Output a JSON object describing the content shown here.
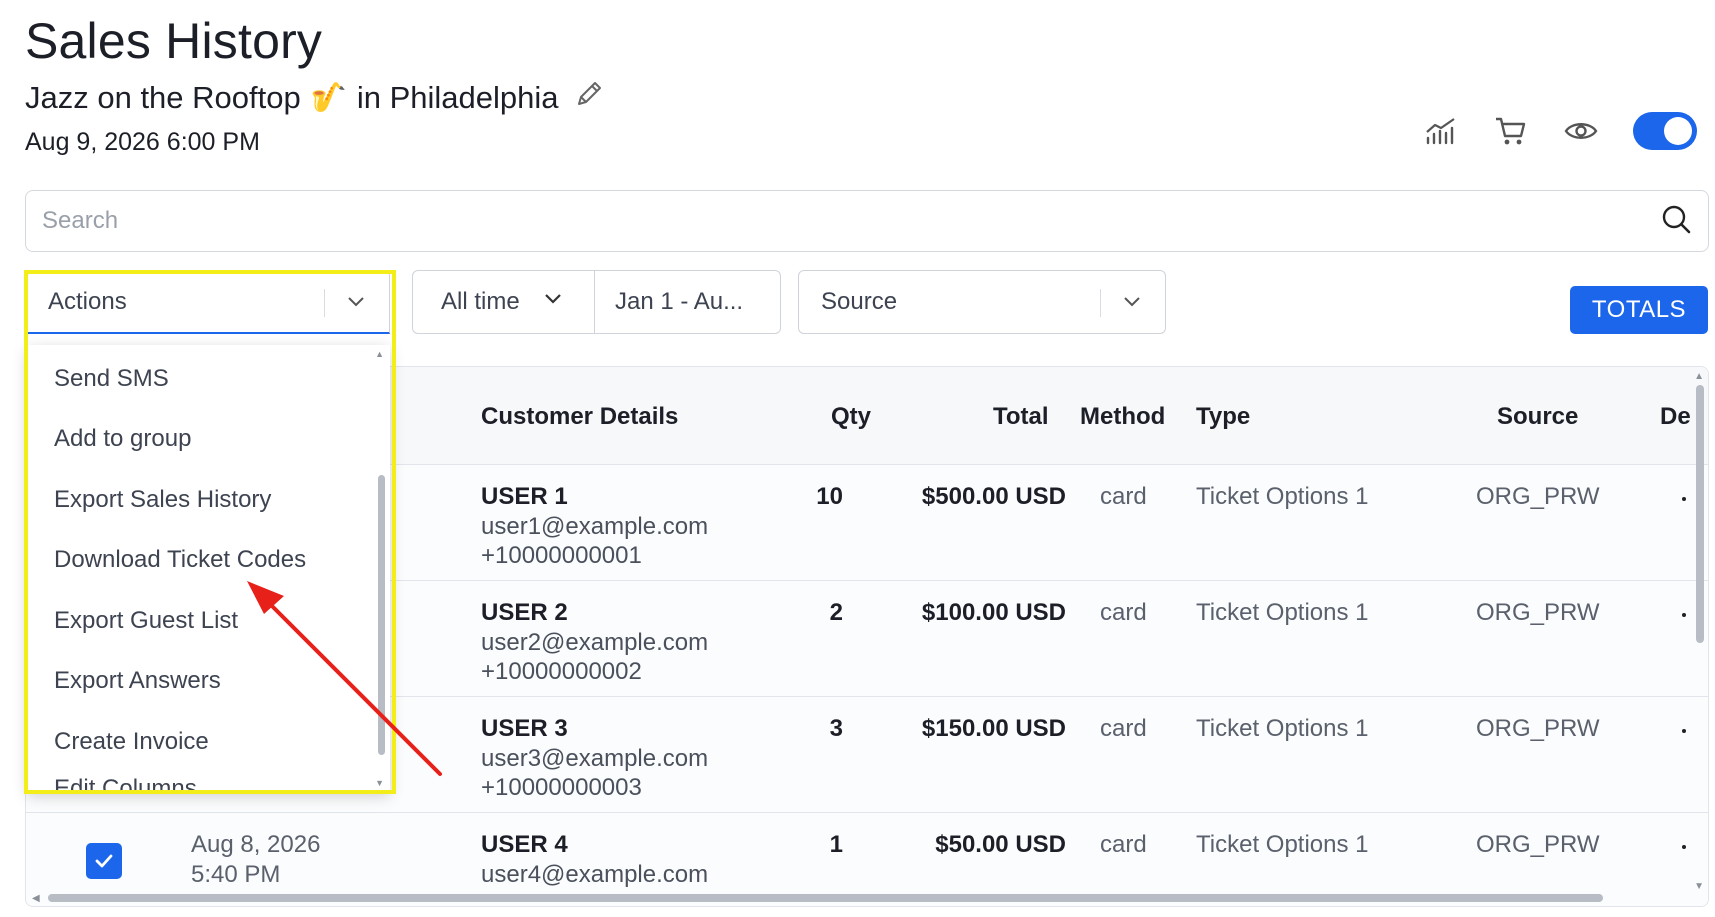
{
  "page": {
    "title": "Sales History",
    "event_name": "Jazz on the Rooftop",
    "event_emoji": "🎷",
    "event_location": "in Philadelphia",
    "event_datetime": "Aug 9, 2026 6:00 PM"
  },
  "toolbar_icons": [
    "analytics-icon",
    "cart-icon",
    "eye-icon",
    "toggle-switch"
  ],
  "search": {
    "placeholder": "Search",
    "value": ""
  },
  "filters": {
    "actions_label": "Actions",
    "time_label": "All time",
    "date_range": "Jan 1 - Au...",
    "source_label": "Source"
  },
  "totals_button": "TOTALS",
  "actions_menu": {
    "items": [
      "Send SMS",
      "Add to group",
      "Export Sales History",
      "Download Ticket Codes",
      "Export Guest List",
      "Export Answers",
      "Create Invoice"
    ],
    "partial_item": "Edit Columns"
  },
  "table": {
    "headers": {
      "customer": "Customer Details",
      "qty": "Qty",
      "total": "Total",
      "method": "Method",
      "type": "Type",
      "source": "Source",
      "extra": "De"
    },
    "rows": [
      {
        "name": "USER 1",
        "email": "user1@example.com",
        "phone": "+10000000001",
        "qty": "10",
        "total": "$500.00 USD",
        "method": "card",
        "type": "Ticket Options 1",
        "source": "ORG_PRW"
      },
      {
        "name": "USER 2",
        "email": "user2@example.com",
        "phone": "+10000000002",
        "qty": "2",
        "total": "$100.00 USD",
        "method": "card",
        "type": "Ticket Options 1",
        "source": "ORG_PRW"
      },
      {
        "name": "USER 3",
        "email": "user3@example.com",
        "phone": "+10000000003",
        "qty": "3",
        "total": "$150.00 USD",
        "method": "card",
        "type": "Ticket Options 1",
        "source": "ORG_PRW"
      },
      {
        "name": "USER 4",
        "email": "user4@example.com",
        "phone": "",
        "date": "Aug 8, 2026",
        "time": "5:40 PM",
        "qty": "1",
        "total": "$50.00 USD",
        "method": "card",
        "type": "Ticket Options 1",
        "source": "ORG_PRW",
        "checked": true
      }
    ]
  },
  "colors": {
    "accent": "#1b66ea",
    "highlight": "#f3ee1a",
    "annotation_arrow": "#e8201a"
  }
}
